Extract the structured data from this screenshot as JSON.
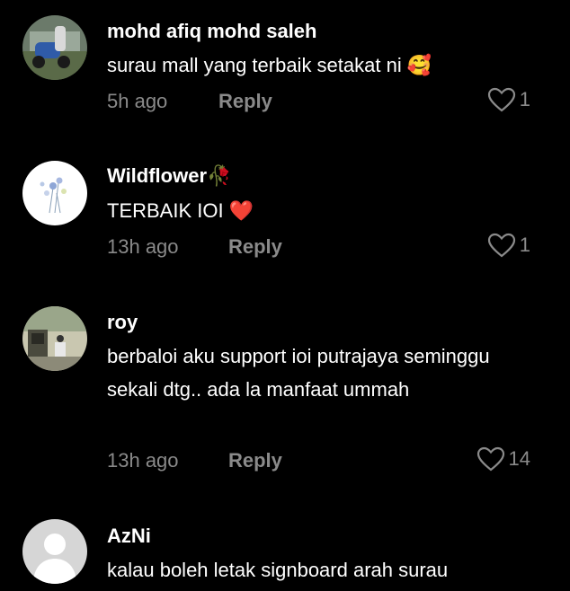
{
  "colors": {
    "background": "#000000",
    "text_primary": "#ffffff",
    "text_secondary": "#8a8a8a",
    "heart_emoji": "#ff2a3a"
  },
  "comments": [
    {
      "username": "mohd afiq mohd saleh",
      "text": "surau mall yang terbaik setakat ni 🥰",
      "time": "5h ago",
      "reply_label": "Reply",
      "likes": "1",
      "avatar": "scooter-photo"
    },
    {
      "username": "Wildflower🥀",
      "text": "TERBAIK IOI ❤️",
      "time": "13h ago",
      "reply_label": "Reply",
      "likes": "1",
      "avatar": "flower-illustration"
    },
    {
      "username": "roy",
      "text": "berbaloi aku support ioi putrajaya seminggu sekali dtg.. ada la manfaat ummah",
      "time": "13h ago",
      "reply_label": "Reply",
      "likes": "14",
      "avatar": "building-photo"
    },
    {
      "username": "AzNi",
      "text": "kalau boleh letak signboard arah surau",
      "avatar": "default-user-icon"
    }
  ]
}
